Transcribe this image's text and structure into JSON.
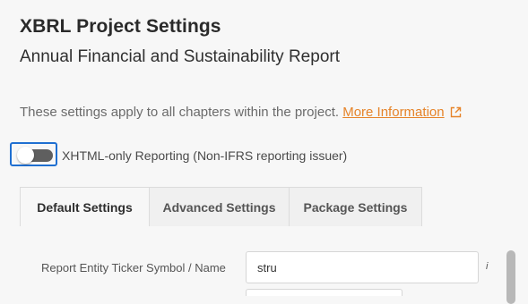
{
  "header": {
    "title": "XBRL Project Settings",
    "subtitle": "Annual Financial and Sustainability Report"
  },
  "info": {
    "text": "These settings apply to all chapters within the project. ",
    "link_label": "More Information"
  },
  "toggle": {
    "label": "XHTML-only Reporting (Non-IFRS reporting issuer)",
    "checked": false
  },
  "tabs": [
    {
      "label": "Default Settings",
      "active": true
    },
    {
      "label": "Advanced Settings",
      "active": false
    },
    {
      "label": "Package Settings",
      "active": false
    }
  ],
  "fields": [
    {
      "label": "Report Entity Ticker Symbol / Name",
      "value": "stru",
      "info_marker": "i"
    }
  ],
  "colors": {
    "link": "#e6842a",
    "focus_ring": "#1f6fd1",
    "toggle_off": "#5f5f5f"
  }
}
